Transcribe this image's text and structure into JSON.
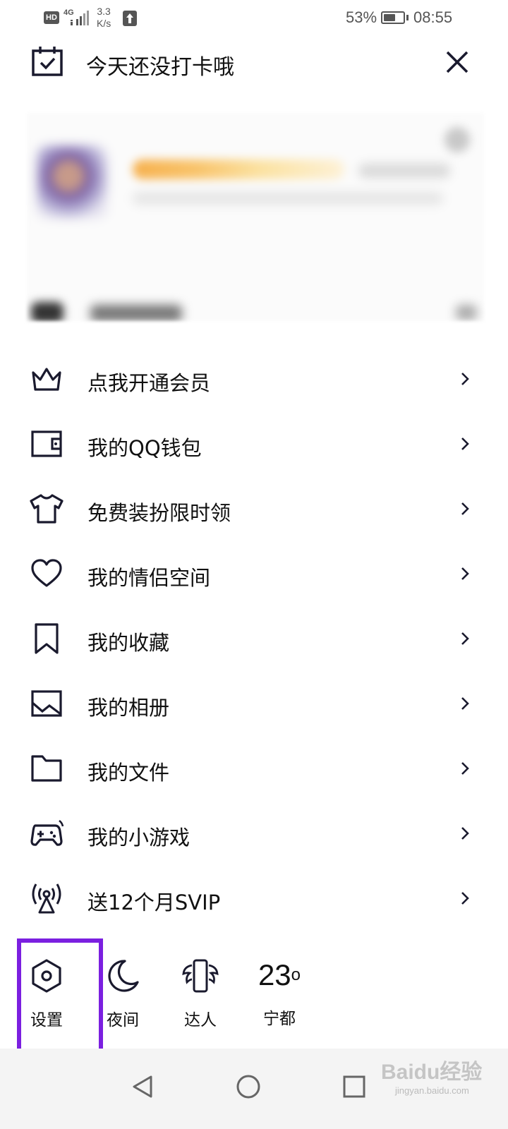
{
  "status_bar": {
    "hd": "HD",
    "network": "4G",
    "speed_value": "3.3",
    "speed_unit": "K/s",
    "battery_percent": "53%",
    "battery_level": 0.53,
    "time": "08:55"
  },
  "checkin": {
    "text": "今天还没打卡哦",
    "icon": "calendar-check-icon",
    "close_icon": "close-icon"
  },
  "menu": [
    {
      "label": "点我开通会员",
      "icon": "crown-icon"
    },
    {
      "label": "我的QQ钱包",
      "icon": "wallet-icon"
    },
    {
      "label": "免费装扮限时领",
      "icon": "tshirt-icon"
    },
    {
      "label": "我的情侣空间",
      "icon": "heart-icon"
    },
    {
      "label": "我的收藏",
      "icon": "bookmark-icon"
    },
    {
      "label": "我的相册",
      "icon": "image-icon"
    },
    {
      "label": "我的文件",
      "icon": "folder-icon"
    },
    {
      "label": "我的小游戏",
      "icon": "gamepad-icon"
    },
    {
      "label": "送12个月SVIP",
      "icon": "broadcast-icon"
    }
  ],
  "bottom_bar": {
    "settings": {
      "label": "设置",
      "icon": "hexagon-settings-icon"
    },
    "night": {
      "label": "夜间",
      "icon": "moon-icon"
    },
    "expert": {
      "label": "达人",
      "icon": "phone-wings-icon"
    },
    "weather": {
      "temp": "23",
      "unit": "o",
      "city": "宁都"
    }
  },
  "highlight_color": "#7b1fe0",
  "watermark": {
    "brand": "Baidu经验",
    "url": "jingyan.baidu.com"
  }
}
